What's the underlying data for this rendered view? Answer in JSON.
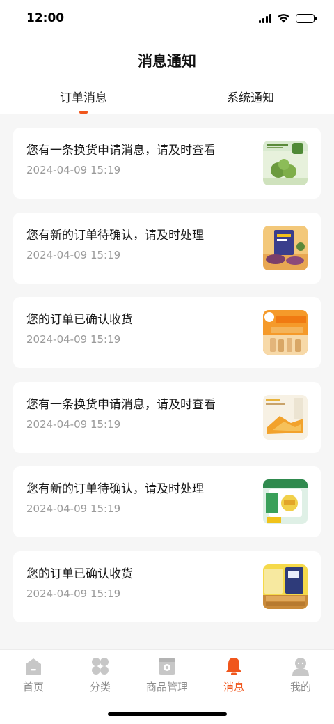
{
  "status_bar": {
    "time": "12:00"
  },
  "header": {
    "title": "消息通知"
  },
  "tabs": [
    {
      "label": "订单消息",
      "active": true
    },
    {
      "label": "系统通知",
      "active": false
    }
  ],
  "messages": [
    {
      "title": "您有一条换货申请消息，请及时查看",
      "time": "2024-04-09 15:19",
      "thumb": "product-image-green-snack"
    },
    {
      "title": "您有新的订单待确认，请及时处理",
      "time": "2024-04-09 15:19",
      "thumb": "product-image-sweet-potato"
    },
    {
      "title": "您的订单已确认收货",
      "time": "2024-04-09 15:19",
      "thumb": "product-image-orange-biscuit"
    },
    {
      "title": "您有一条换货申请消息，请及时查看",
      "time": "2024-04-09 15:19",
      "thumb": "product-image-chips"
    },
    {
      "title": "您有新的订单待确认，请及时处理",
      "time": "2024-04-09 15:19",
      "thumb": "product-image-grain-crackers"
    },
    {
      "title": "您的订单已确认收货",
      "time": "2024-04-09 15:19",
      "thumb": "product-image-egg-rolls"
    }
  ],
  "tabbar": [
    {
      "label": "首页",
      "icon": "home-icon",
      "active": false
    },
    {
      "label": "分类",
      "icon": "category-icon",
      "active": false
    },
    {
      "label": "商品管理",
      "icon": "product-manage-icon",
      "active": false
    },
    {
      "label": "消息",
      "icon": "bell-icon",
      "active": true
    },
    {
      "label": "我的",
      "icon": "user-icon",
      "active": false
    }
  ],
  "colors": {
    "accent": "#f0561c",
    "inactive": "#8c8c8c",
    "background": "#f6f6f6"
  }
}
